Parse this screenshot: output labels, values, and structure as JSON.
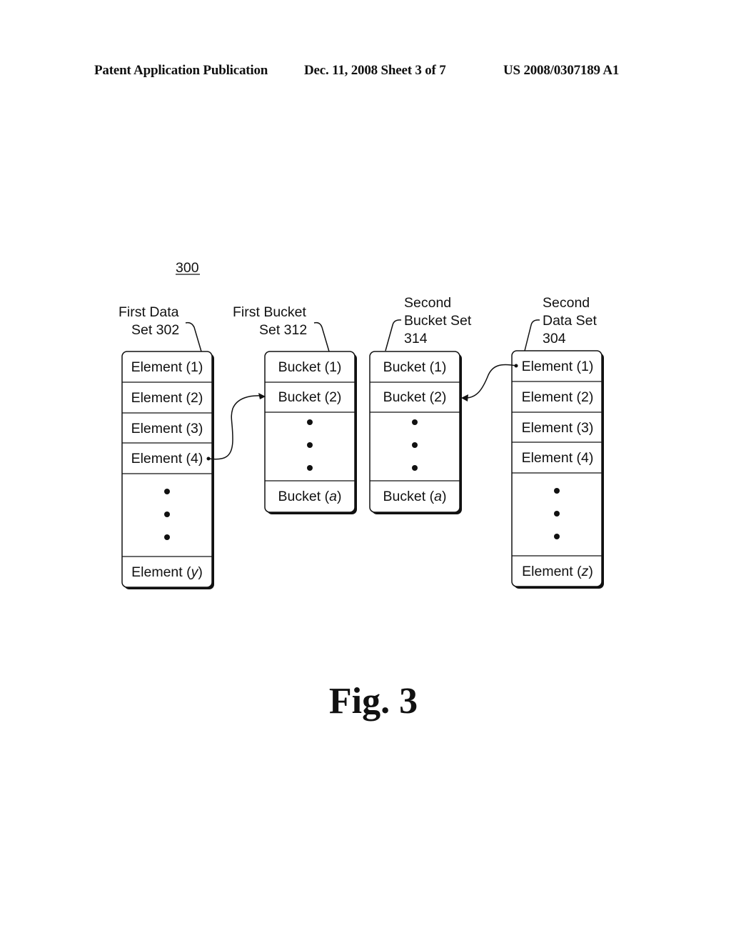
{
  "header": {
    "left": "Patent Application Publication",
    "center": "Dec. 11, 2008   Sheet 3 of 7",
    "right": "US 2008/0307189 A1"
  },
  "figure": {
    "reference": "300",
    "caption": "Fig. 3",
    "sets": [
      {
        "id": "first-data-set",
        "label_lines": [
          "First Data",
          "Set 302"
        ],
        "cells": [
          "Element (1)",
          "Element (2)",
          "Element (3)",
          "Element (4)",
          "ellipsis",
          "Element (y)"
        ]
      },
      {
        "id": "first-bucket-set",
        "label_lines": [
          "First Bucket",
          "Set 312"
        ],
        "cells": [
          "Bucket (1)",
          "Bucket (2)",
          "ellipsis",
          "Bucket (a)"
        ]
      },
      {
        "id": "second-bucket-set",
        "label_lines": [
          "Second",
          "Bucket Set",
          "314"
        ],
        "cells": [
          "Bucket (1)",
          "Bucket (2)",
          "ellipsis",
          "Bucket (a)"
        ]
      },
      {
        "id": "second-data-set",
        "label_lines": [
          "Second",
          "Data Set",
          "304"
        ],
        "cells": [
          "Element (1)",
          "Element (2)",
          "Element (3)",
          "Element (4)",
          "ellipsis",
          "Element (z)"
        ]
      }
    ],
    "arrows": [
      {
        "from": "First Data Set: Element (4)",
        "to": "First Bucket Set: Bucket (2)"
      },
      {
        "from": "Second Data Set: Element (1)",
        "to": "Second Bucket Set: Bucket (2)"
      }
    ]
  }
}
